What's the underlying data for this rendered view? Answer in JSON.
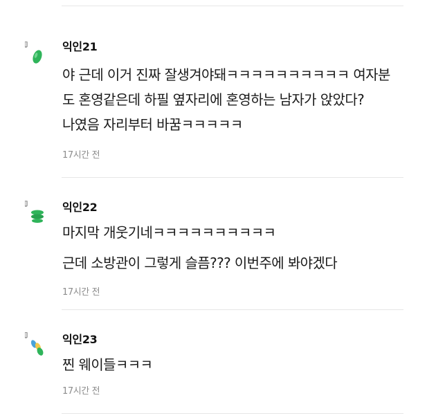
{
  "comments": [
    {
      "author": "익인21",
      "lines": [
        "야 근데 이거 진짜 잘생겨야돼ㅋㅋㅋㅋㅋㅋㅋㅋㅋㅋ 여자분",
        "도 혼영같은데 하필 옆자리에 혼영하는 남자가 앉았다?",
        "나였음 자리부터 바꿈ㅋㅋㅋㅋㅋ"
      ],
      "time": "17시간 전",
      "avatar_icon": "green-blob-icon"
    },
    {
      "author": "익인22",
      "lines": [
        "마지막 개웃기네ㅋㅋㅋㅋㅋㅋㅋㅋㅋㅋ",
        "근데 소방관이 그렇게 슬픔??? 이번주에 봐야겠다"
      ],
      "time": "17시간 전",
      "avatar_icon": "green-stack-icon"
    },
    {
      "author": "익인23",
      "lines": [
        "찐 웨이들ㅋㅋㅋ"
      ],
      "time": "17시간 전",
      "avatar_icon": "blue-green-drops-icon"
    }
  ],
  "colors": {
    "avatar_green": "#2fb45a",
    "avatar_blue": "#4aa3d8",
    "avatar_yellow": "#f2c94c",
    "divider": "#e6e6e6",
    "meta_text": "#8c8c8c"
  }
}
